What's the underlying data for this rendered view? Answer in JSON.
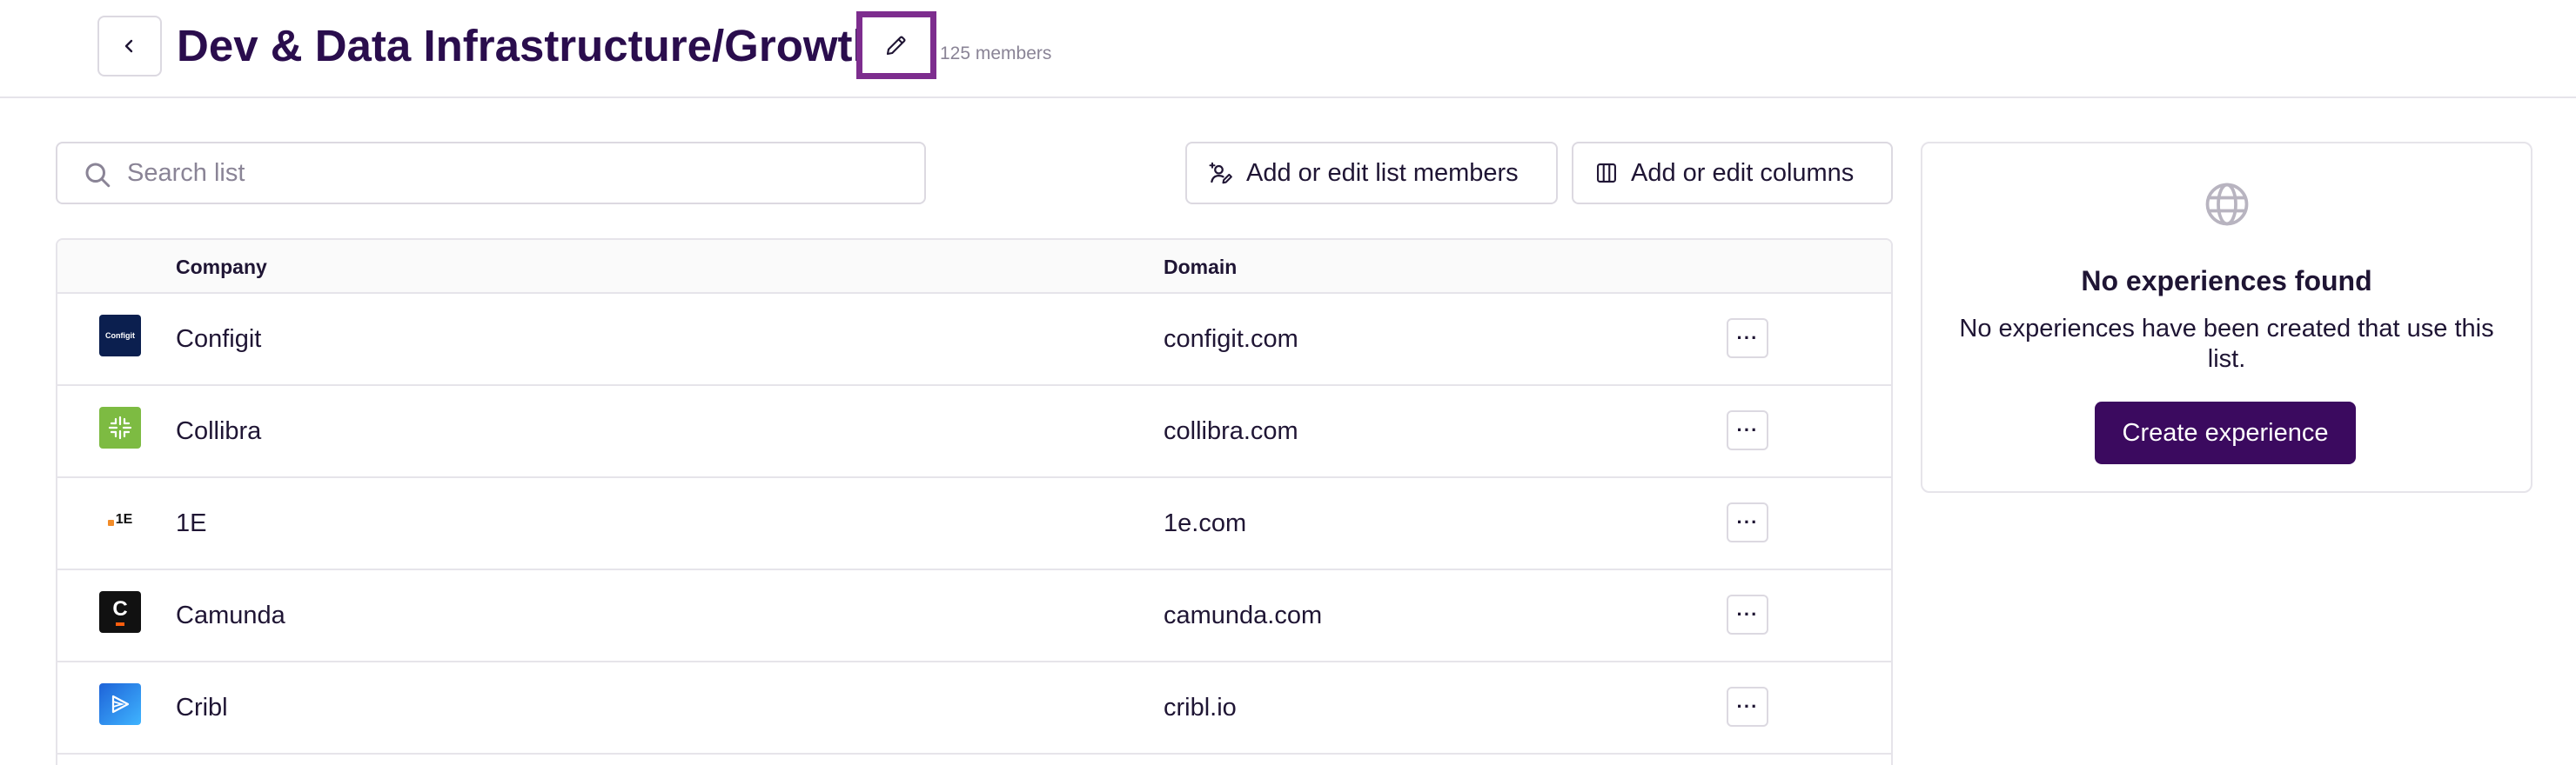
{
  "header": {
    "title": "Dev & Data Infrastructure/Growth",
    "members_count": "125 members"
  },
  "search": {
    "placeholder": "Search list",
    "value": ""
  },
  "toolbar": {
    "add_members_label": "Add or edit list members",
    "add_columns_label": "Add or edit columns"
  },
  "table": {
    "columns": [
      "Company",
      "Domain"
    ],
    "rows": [
      {
        "company": "Configit",
        "domain": "configit.com",
        "logo_text": "Configit",
        "logo_bg": "#0b1f4f"
      },
      {
        "company": "Collibra",
        "domain": "collibra.com",
        "logo_text": "",
        "logo_bg": "#7dbb42"
      },
      {
        "company": "1E",
        "domain": "1e.com",
        "logo_text": "1E",
        "logo_bg": "#ffffff"
      },
      {
        "company": "Camunda",
        "domain": "camunda.com",
        "logo_text": "C",
        "logo_bg": "#111111"
      },
      {
        "company": "Cribl",
        "domain": "cribl.io",
        "logo_text": "",
        "logo_bg": "#2a7de1"
      }
    ],
    "more_label": "···"
  },
  "side_panel": {
    "title": "No experiences found",
    "description": "No experiences have been created that use this list.",
    "button_label": "Create experience"
  },
  "colors": {
    "brand": "#3b0a5f",
    "title": "#2a0d4d",
    "highlight_border": "#7d2d8e"
  },
  "icons": {
    "back": "chevron-left-icon",
    "edit": "pencil-icon",
    "search": "search-icon",
    "members": "user-edit-icon",
    "columns": "columns-icon",
    "empty_state": "globe-icon"
  }
}
